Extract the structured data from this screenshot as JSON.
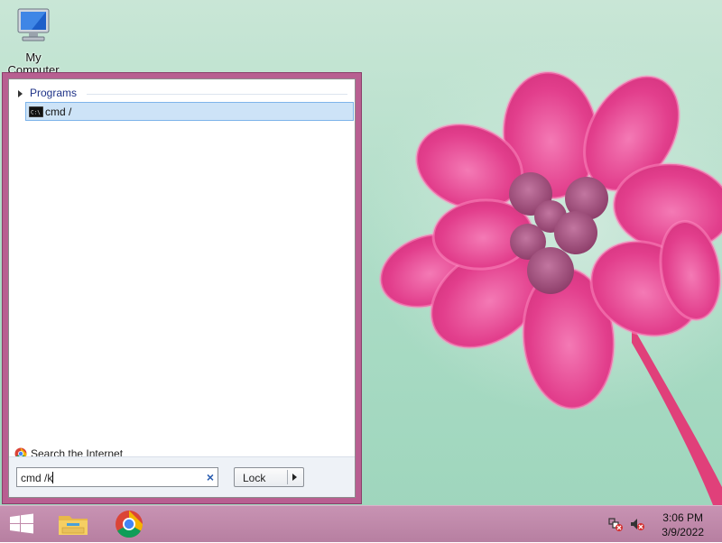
{
  "desktop": {
    "icons": [
      {
        "label": "My Computer",
        "icon": "computer-icon"
      }
    ]
  },
  "start_menu": {
    "section_label": "Programs",
    "results": [
      {
        "label": "cmd /",
        "icon": "command-prompt-icon"
      }
    ],
    "search_internet_label": "Search the Internet",
    "search_value": "cmd /k",
    "clear_glyph": "×",
    "power_button_label": "Lock"
  },
  "taskbar": {
    "items": [
      {
        "name": "start",
        "icon": "windows-logo-icon"
      },
      {
        "name": "file-explorer",
        "icon": "folder-icon"
      },
      {
        "name": "chrome",
        "icon": "chrome-icon"
      }
    ],
    "tray": [
      {
        "icon": "network-disconnected-icon"
      },
      {
        "icon": "volume-muted-icon"
      }
    ],
    "time": "3:06 PM",
    "date": "3/9/2022"
  },
  "colors": {
    "start_menu_frame": "#b85f91",
    "selection_fill": "#cde3f7",
    "selection_border": "#7eb4ea",
    "taskbar": "#c18aac",
    "flower": "#e43d8a"
  }
}
